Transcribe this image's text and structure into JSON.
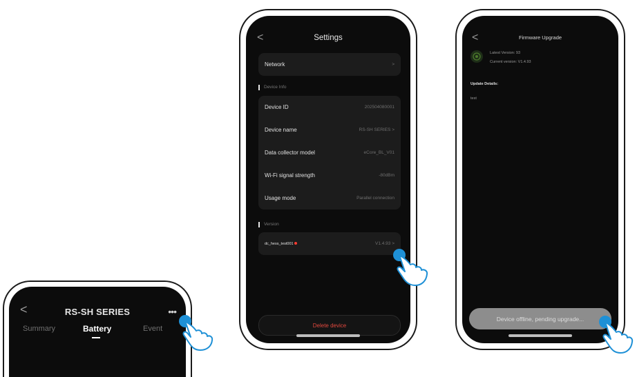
{
  "phone1": {
    "title": "RS-SH SERIES",
    "back_glyph": "<",
    "more_glyph": "•••",
    "tabs": [
      {
        "label": "Summary",
        "active": false
      },
      {
        "label": "Battery",
        "active": true
      },
      {
        "label": "Event",
        "active": false
      }
    ]
  },
  "settings": {
    "back_glyph": "<",
    "title": "Settings",
    "network_label": "Network",
    "device_info_header": "Device Info",
    "rows": [
      {
        "label": "Device ID",
        "value": "202504080001"
      },
      {
        "label": "Device name",
        "value": "RS-SH SERIES >"
      },
      {
        "label": "Data collector model",
        "value": "eCore_BL_V01"
      },
      {
        "label": "Wi-Fi signal strength",
        "value": "-80dBm"
      },
      {
        "label": "Usage mode",
        "value": "Parallel connection"
      }
    ],
    "version_header": "Version",
    "version_row": {
      "label": "dc_hess_test001",
      "value": "V1.4.93 >"
    },
    "delete_label": "Delete device"
  },
  "firmware": {
    "back_glyph": "<",
    "title": "Firmware Upgrade",
    "latest_version": "Latest Version:  93",
    "current_version": "Current version:  V1.4.93",
    "update_details_label": "Update Details:",
    "update_details_text": "test",
    "upgrade_button": "Device offline, pending upgrade..."
  },
  "icons": {
    "pointer": "pointing-hand-icon",
    "firmware": "upgrade-icon"
  },
  "colors": {
    "screen_bg": "#0c0c0c",
    "card_bg": "#1c1c1c",
    "delete_red": "#e2483e",
    "tap_blue": "#1e90d6",
    "upgrade_button_grey": "#8d8d8d"
  }
}
